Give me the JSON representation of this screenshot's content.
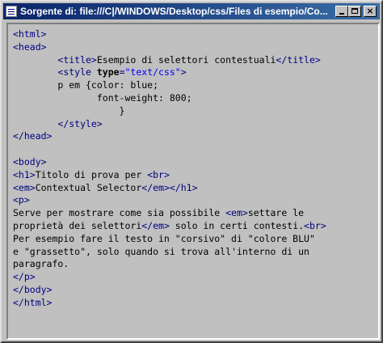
{
  "window": {
    "title": "Sorgente di: file:///C|/WINDOWS/Desktop/css/Files di esempio/Co...",
    "buttons": {
      "minimize": "minimize",
      "maximize": "maximize",
      "close": "×"
    }
  },
  "colors": {
    "tag": "#000080",
    "attribute": "#000000",
    "value": "#0000ff",
    "text": "#000000"
  },
  "source_lines": [
    [
      {
        "t": "<html>",
        "k": "tag"
      }
    ],
    [
      {
        "t": "<head>",
        "k": "tag"
      }
    ],
    [
      {
        "t": "        "
      },
      {
        "t": "<title>",
        "k": "tag"
      },
      {
        "t": "Esempio di selettori contestuali"
      },
      {
        "t": "</title>",
        "k": "tag"
      }
    ],
    [
      {
        "t": "        "
      },
      {
        "t": "<style ",
        "k": "tag"
      },
      {
        "t": "type",
        "k": "attr"
      },
      {
        "t": "=",
        "k": "tag"
      },
      {
        "t": "\"text/css\"",
        "k": "val"
      },
      {
        "t": ">",
        "k": "tag"
      }
    ],
    [
      {
        "t": "        p em {color: blue;"
      }
    ],
    [
      {
        "t": "               font-weight: 800;"
      }
    ],
    [
      {
        "t": "                   }"
      }
    ],
    [
      {
        "t": "        "
      },
      {
        "t": "</style>",
        "k": "tag"
      }
    ],
    [
      {
        "t": "</head>",
        "k": "tag"
      }
    ],
    [
      {
        "t": ""
      }
    ],
    [
      {
        "t": "<body>",
        "k": "tag"
      }
    ],
    [
      {
        "t": "<h1>",
        "k": "tag"
      },
      {
        "t": "Titolo di prova per "
      },
      {
        "t": "<br>",
        "k": "tag"
      }
    ],
    [
      {
        "t": "<em>",
        "k": "tag"
      },
      {
        "t": "Contextual Selector"
      },
      {
        "t": "</em>",
        "k": "tag"
      },
      {
        "t": "</h1>",
        "k": "tag"
      }
    ],
    [
      {
        "t": "<p>",
        "k": "tag"
      }
    ],
    [
      {
        "t": "Serve per mostrare come sia possibile "
      },
      {
        "t": "<em>",
        "k": "tag"
      },
      {
        "t": "settare le"
      }
    ],
    [
      {
        "t": "proprietà dei selettori"
      },
      {
        "t": "</em>",
        "k": "tag"
      },
      {
        "t": " solo in certi contesti."
      },
      {
        "t": "<br>",
        "k": "tag"
      }
    ],
    [
      {
        "t": "Per esempio fare il testo in \"corsivo\" di \"colore BLU\""
      }
    ],
    [
      {
        "t": "e \"grassetto\", solo quando si trova all'interno di un"
      }
    ],
    [
      {
        "t": "paragrafo."
      }
    ],
    [
      {
        "t": "</p>",
        "k": "tag"
      }
    ],
    [
      {
        "t": "</body>",
        "k": "tag"
      }
    ],
    [
      {
        "t": "</html>",
        "k": "tag"
      }
    ]
  ]
}
